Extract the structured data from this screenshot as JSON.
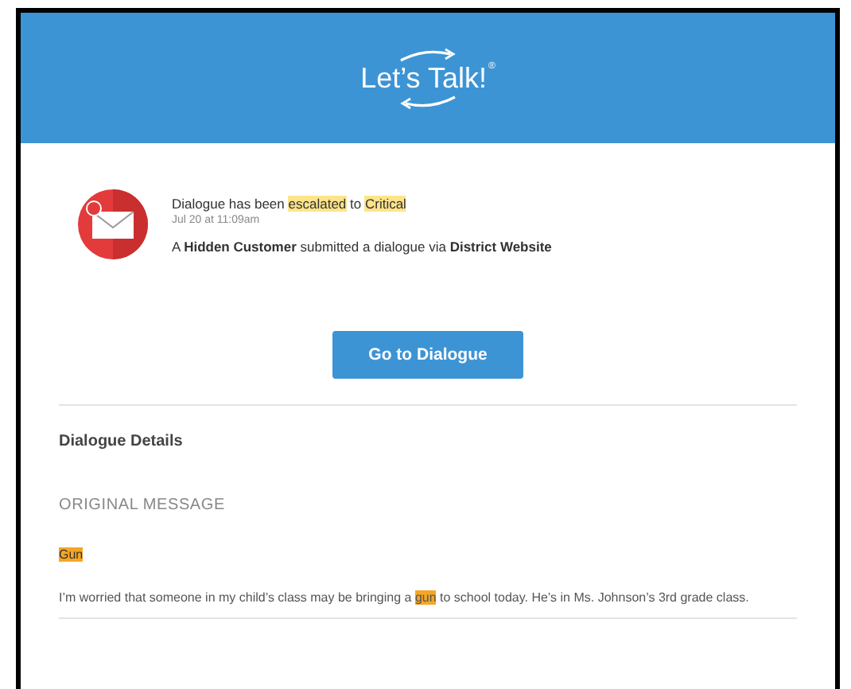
{
  "header": {
    "logo_text": "Let’s Talk!",
    "logo_mark": "®"
  },
  "notification": {
    "headline": [
      {
        "text": "Dialogue has been ",
        "highlighted": false
      },
      {
        "text": "escalated",
        "highlighted": true
      },
      {
        "text": " to ",
        "highlighted": false
      },
      {
        "text": "Critical",
        "highlighted": true
      }
    ],
    "time": "Jul 20 at 11:09am",
    "summary": "A **Hidden Customer** submitted a dialogue via **District Website**"
  },
  "button": "Go to Dialogue",
  "details": {
    "title": "Dialogue Details",
    "section": "ORIGINAL MESSAGE",
    "subject": {
      "text": "Gun",
      "highlighted": true
    },
    "message": [
      {
        "text": "I’m worried that someone in my child’s class may be bringing a ",
        "highlighted": false
      },
      {
        "text": "gun",
        "highlighted": true
      },
      {
        "text": " to school today. He’s in Ms. Johnson’s 3rd grade class.",
        "highlighted": false
      }
    ]
  }
}
